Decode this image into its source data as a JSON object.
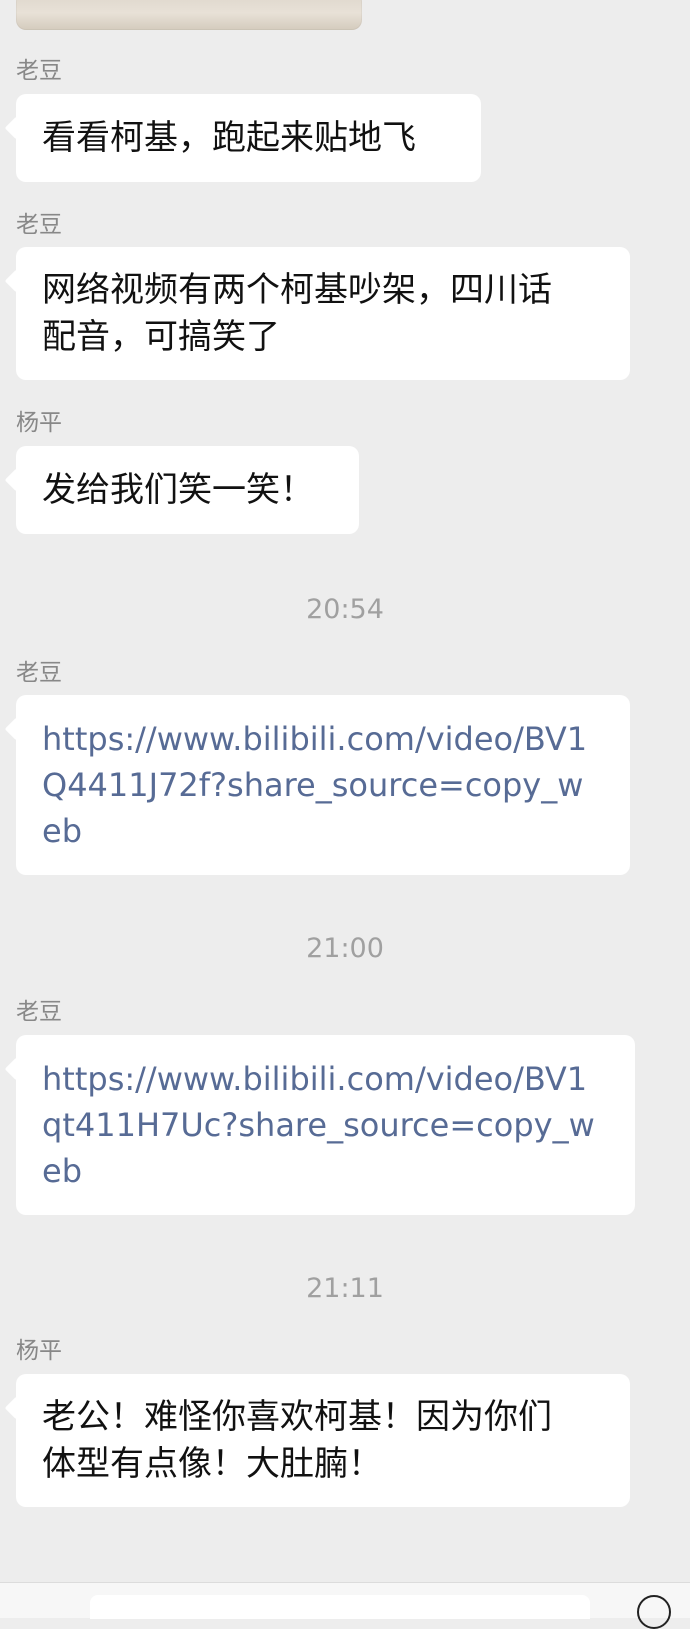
{
  "messages": [
    {
      "sender": "老豆",
      "text": "看看柯基，跑起来贴地飞"
    },
    {
      "sender": "老豆",
      "text": "网络视频有两个柯基吵架，四川话\n配音，可搞笑了"
    },
    {
      "sender": "杨平",
      "text": "发给我们笑一笑！"
    },
    {
      "sender": "老豆",
      "text": "https://www.bilibili.com/video/BV1\nQ4411J72f?share_source=copy_w\neb"
    },
    {
      "sender": "老豆",
      "text": "https://www.bilibili.com/video/BV1\nqt411H7Uc?share_source=copy_w\neb"
    },
    {
      "sender": "杨平",
      "text": "老公！难怪你喜欢柯基！因为你们\n体型有点像！大肚腩！"
    }
  ],
  "timestamps": [
    "20:54",
    "21:00",
    "21:11"
  ],
  "colors": {
    "background": "#ededed",
    "bubble": "#ffffff",
    "sender": "#888888",
    "text": "#111111",
    "link": "#576b95",
    "timestamp": "#a0a0a0"
  }
}
